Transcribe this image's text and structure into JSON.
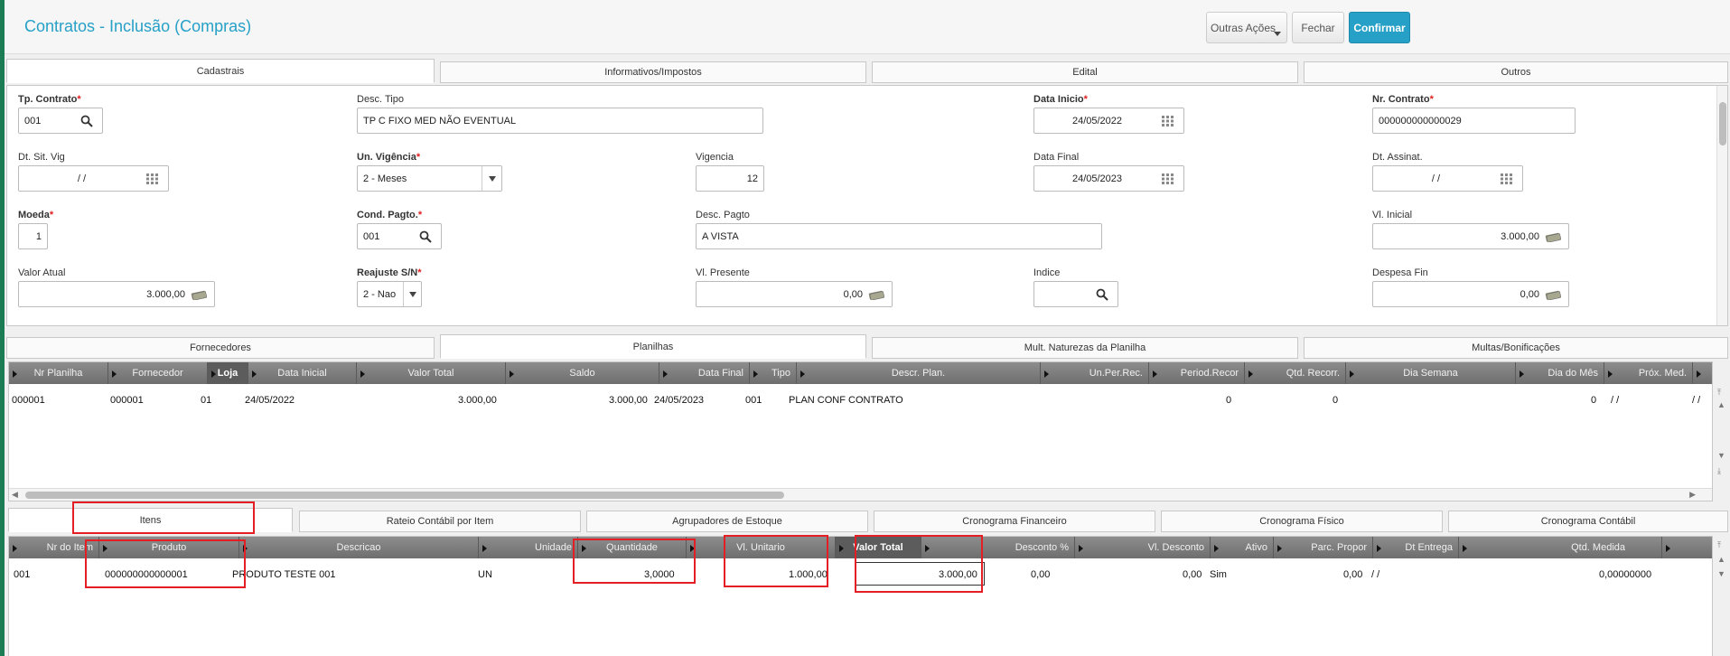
{
  "header": {
    "title": "Contratos - Inclusão (Compras)",
    "buttons": {
      "more": "Outras Ações",
      "close": "Fechar",
      "confirm": "Confirmar"
    }
  },
  "top_tabs": [
    "Cadastrais",
    "Informativos/Impostos",
    "Edital",
    "Outros"
  ],
  "form": {
    "tp_contrato": {
      "label": "Tp. Contrato",
      "value": "001"
    },
    "desc_tipo": {
      "label": "Desc. Tipo",
      "value": "TP C FIXO MED NÃO EVENTUAL"
    },
    "data_inicio": {
      "label": "Data Inicio",
      "value": "24/05/2022"
    },
    "nr_contrato": {
      "label": "Nr. Contrato",
      "value": "000000000000029"
    },
    "dt_sit_vig": {
      "label": "Dt. Sit. Vig",
      "value": "/ /"
    },
    "un_vigencia": {
      "label": "Un. Vigência",
      "value": "2 - Meses"
    },
    "vigencia": {
      "label": "Vigencia",
      "value": "12"
    },
    "data_final": {
      "label": "Data Final",
      "value": "24/05/2023"
    },
    "dt_assinat": {
      "label": "Dt. Assinat.",
      "value": "/ /"
    },
    "moeda": {
      "label": "Moeda",
      "value": "1"
    },
    "cond_pagto": {
      "label": "Cond. Pagto.",
      "value": "001"
    },
    "desc_pagto": {
      "label": "Desc. Pagto",
      "value": "A VISTA"
    },
    "vl_inicial": {
      "label": "Vl. Inicial",
      "value": "3.000,00"
    },
    "valor_atual": {
      "label": "Valor Atual",
      "value": "3.000,00"
    },
    "reajuste": {
      "label": "Reajuste S/N",
      "value": "2 - Nao"
    },
    "vl_presente": {
      "label": "Vl. Presente",
      "value": "0,00"
    },
    "indice": {
      "label": "Indice",
      "value": ""
    },
    "despesa_fin": {
      "label": "Despesa Fin",
      "value": "0,00"
    }
  },
  "mid_tabs": [
    "Fornecedores",
    "Planilhas",
    "Mult. Naturezas da Planilha",
    "Multas/Bonificações"
  ],
  "planilhas": {
    "columns": [
      "Nr Planilha",
      "Fornecedor",
      "Loja",
      "Data Inicial",
      "Valor Total",
      "Saldo",
      "Data Final",
      "Tipo",
      "Descr. Plan.",
      "Un.Per.Rec.",
      "Period.Recor",
      "Qtd. Recorr.",
      "Dia Semana",
      "Dia do Mês",
      "Próx. Med."
    ],
    "row": [
      "000001",
      "000001",
      "01",
      "24/05/2022",
      "3.000,00",
      "3.000,00",
      "24/05/2023",
      "001",
      "PLAN CONF CONTRATO",
      "",
      "0",
      "0",
      "",
      "0",
      "/ /"
    ],
    "extra": "/ /"
  },
  "bottom_tabs": [
    "Itens",
    "Rateio Contábil por Item",
    "Agrupadores de Estoque",
    "Cronograma Financeiro",
    "Cronograma Físico",
    "Cronograma Contábil"
  ],
  "itens": {
    "columns": [
      "Nr do Item",
      "Produto",
      "Descricao",
      "Unidade",
      "Quantidade",
      "Vl. Unitario",
      "Valor Total",
      "Desconto %",
      "Vl. Desconto",
      "Ativo",
      "Parc. Propor",
      "Dt Entrega",
      "Qtd. Medida"
    ],
    "row": [
      "001",
      "000000000000001",
      "PRODUTO TESTE 001",
      "UN",
      "3,0000",
      "1.000,00",
      "3.000,00",
      "0,00",
      "0,00",
      "Sim",
      "0,00",
      "/ /",
      "0,00000000"
    ]
  }
}
